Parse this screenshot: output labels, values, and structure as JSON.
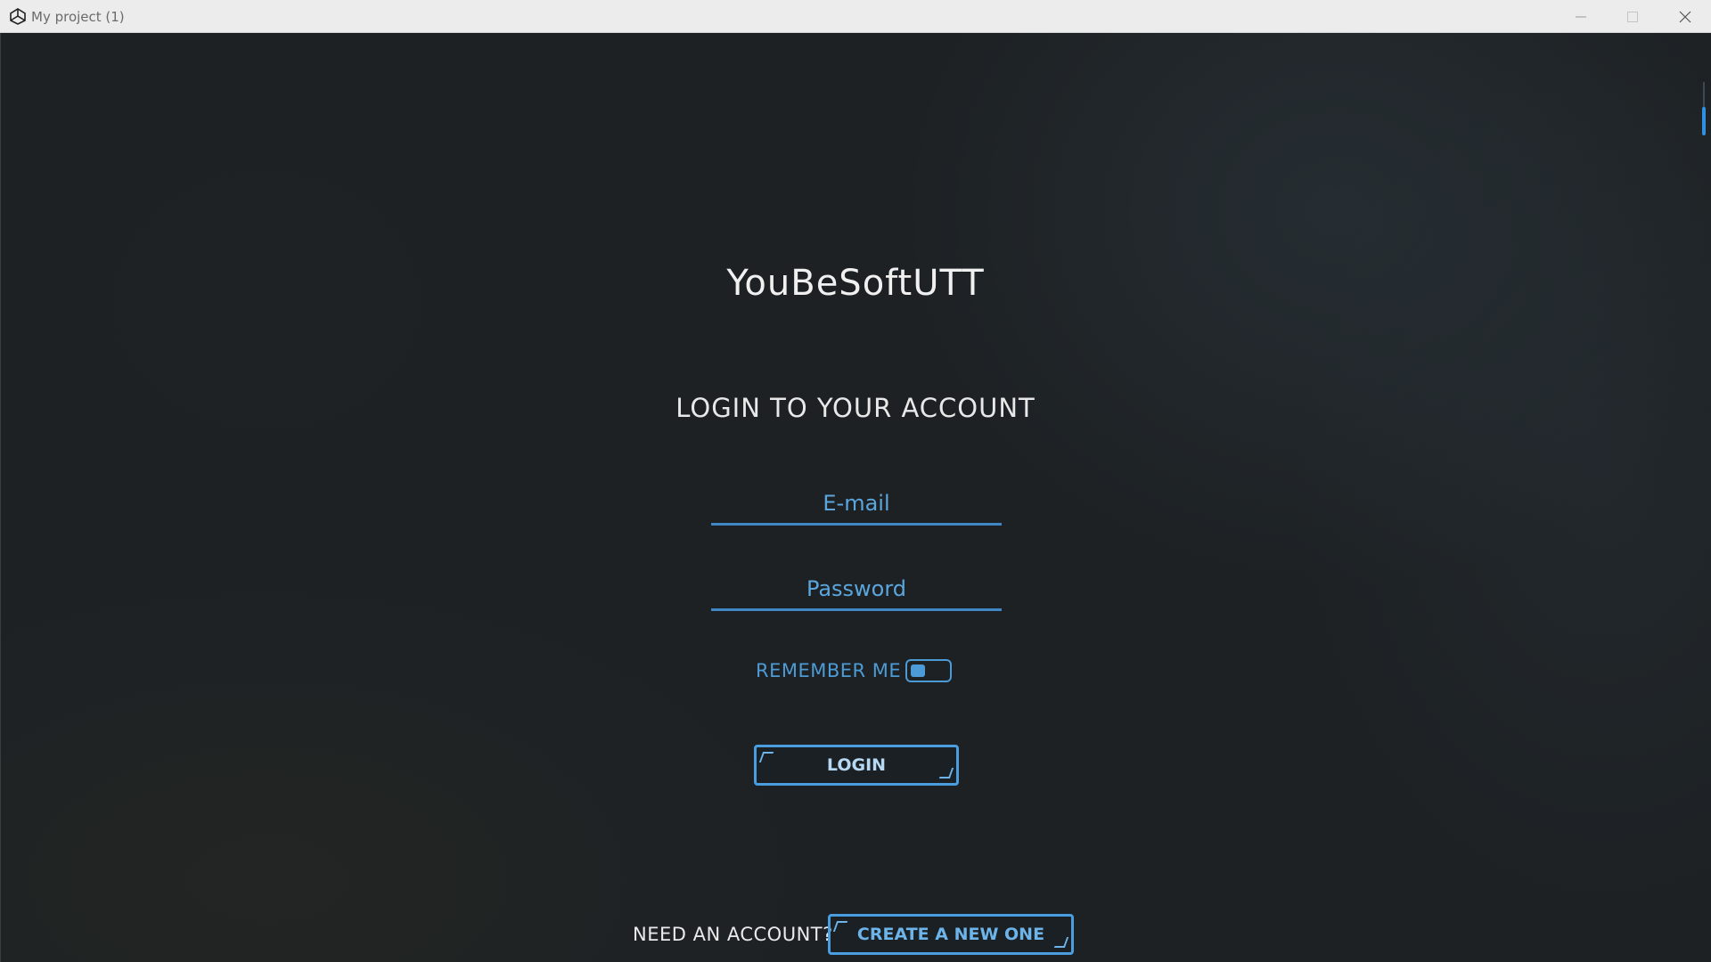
{
  "window": {
    "title": "My project (1)",
    "icon": "unity-icon",
    "controls": {
      "minimize_icon": "minimize-icon",
      "maximize_icon": "maximize-icon",
      "close_icon": "close-icon"
    }
  },
  "app": {
    "name": "YouBeSoftUTT"
  },
  "login": {
    "heading": "LOGIN TO YOUR ACCOUNT",
    "email": {
      "placeholder": "E-mail",
      "value": ""
    },
    "password": {
      "placeholder": "Password",
      "value": ""
    },
    "remember_me": {
      "label": "REMEMBER ME",
      "checked": false
    },
    "login_button_label": "LOGIN"
  },
  "signup": {
    "prompt": "NEED AN ACCOUNT?",
    "create_button_label": "CREATE A NEW ONE"
  },
  "colors": {
    "accent": "#4a9ee0",
    "background": "#1d2124",
    "text_primary": "#f0f0f0"
  }
}
